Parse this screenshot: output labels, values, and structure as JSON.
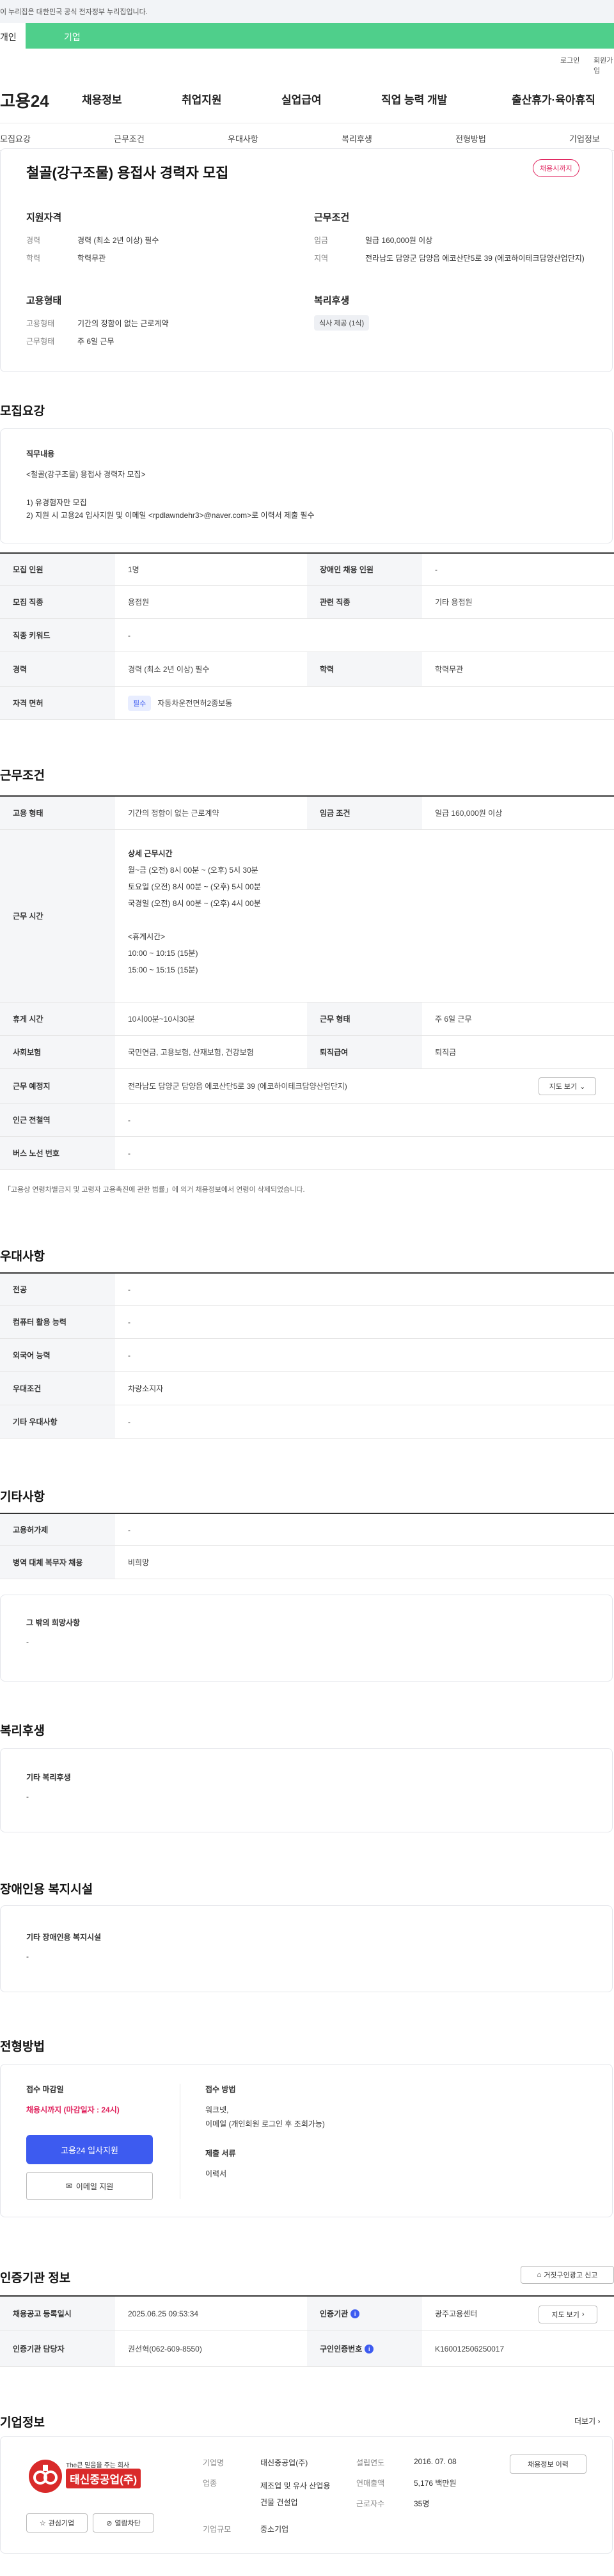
{
  "topbar": {
    "notice": "이 누리집은 대한민국 공식 전자정부 누리집입니다."
  },
  "site_tabs": [
    "개인",
    "기업"
  ],
  "util_links": [
    "로그인",
    "회원가입"
  ],
  "logo": "고용24",
  "gnb": [
    "채용정보",
    "취업지원",
    "실업급여",
    "직업 능력 개발",
    "출산휴가·육아휴직"
  ],
  "subnav": [
    "모집요강",
    "근무조건",
    "우대사항",
    "복리후생",
    "전형방법",
    "기업정보"
  ],
  "header": {
    "title": "철골(강구조물) 용접사 경력자 모집",
    "deadline_badge": "채용시까지",
    "qual_title": "지원자격",
    "qual": [
      {
        "label": "경력",
        "value": "경력 (최소 2년 이상) 필수"
      },
      {
        "label": "학력",
        "value": "학력무관"
      }
    ],
    "cond_title": "근무조건",
    "cond": [
      {
        "label": "임금",
        "value": "일급 160,000원 이상"
      },
      {
        "label": "지역",
        "value": "전라남도 담양군 담양읍 에코산단5로 39 (에코하이테크담양산업단지)"
      }
    ],
    "emp_title": "고용형태",
    "emp": [
      {
        "label": "고용형태",
        "value": "기간의 정함이 없는 근로계약"
      },
      {
        "label": "근무형태",
        "value": "주 6일 근무"
      }
    ],
    "welfare_title": "복리후생",
    "welfare_tag": "식사 제공 (1식)"
  },
  "recruit": {
    "title": "모집요강",
    "duty_label": "직무내용",
    "duty_lines": [
      "<철골(강구조물) 용접사 경력자 모집>",
      "",
      "1) 유경험자만 모집",
      "2) 지원 시 고용24 입사지원 및 이메일 <rpdlawndehr3>@naver.com>로 이력서 제출 필수"
    ],
    "rows": [
      {
        "k1": "모집 인원",
        "v1": "1명",
        "k2": "장애인 채용 인원",
        "v2": "-"
      },
      {
        "k1": "모집 직종",
        "v1": "용접원",
        "k2": "관련 직종",
        "v2": "기타 용접원"
      },
      {
        "k1": "직종 키워드",
        "v1": "-"
      },
      {
        "k1": "경력",
        "v1": "경력 (최소 2년 이상) 필수",
        "k2": "학력",
        "v2": "학력무관"
      }
    ],
    "license_label": "자격 면허",
    "license_tag": "필수",
    "license_value": "자동차운전면허2종보통"
  },
  "work": {
    "title": "근무조건",
    "type_label": "고용 형태",
    "type_value": "기간의 정함이 없는 근로계약",
    "pay_label": "임금 조건",
    "pay_value": "일급 160,000원 이상",
    "hours_label": "근무 시간",
    "hours_lines": [
      "상세 근무시간",
      "월~금  (오전) 8시 00분 ~ (오후) 5시 30분",
      "토요일  (오전) 8시 00분 ~ (오후) 5시 00분",
      "국경일  (오전) 8시 00분 ~ (오후) 4시 00분",
      "",
      "<휴게시간>",
      "10:00 ~ 10:15 (15분)",
      "15:00 ~ 15:15 (15분)"
    ],
    "rest_label": "휴게 시간",
    "rest_value": "10시00분~10시30분",
    "form_label": "근무 형태",
    "form_value": "주 6일 근무",
    "ins_label": "사회보험",
    "ins_value": "국민연금, 고용보험, 산재보험, 건강보험",
    "sev_label": "퇴직급여",
    "sev_value": "퇴직금",
    "place_label": "근무 예정지",
    "place_value": "전라남도 담양군 담양읍 에코산단5로 39 (에코하이테크담양산업단지)",
    "map_btn": "지도 보기",
    "subway_label": "인근 전철역",
    "subway_value": "-",
    "bus_label": "버스 노선 번호",
    "bus_value": "-",
    "note": "「고용상 연령차별금지 및 고령자 고용촉진에 관한 법률」에 의거 채용정보에서 연령이 삭제되었습니다."
  },
  "pref": {
    "title": "우대사항",
    "rows": [
      {
        "k": "전공",
        "v": "-"
      },
      {
        "k": "컴퓨터 활용 능력",
        "v": "-"
      },
      {
        "k": "외국어 능력",
        "v": "-"
      },
      {
        "k": "우대조건",
        "v": "차량소지자"
      },
      {
        "k": "기타 우대사항",
        "v": "-"
      }
    ]
  },
  "other": {
    "title": "기타사항",
    "rows": [
      {
        "k": "고용허가제",
        "v": "-"
      },
      {
        "k": "병역 대체 복무자 채용",
        "v": "비희망"
      }
    ],
    "box_label": "그 밖의 희망사항",
    "box_value": "-"
  },
  "welfare": {
    "title": "복리후생",
    "box_label": "기타 복리후생",
    "box_value": "-"
  },
  "disabled": {
    "title": "장애인용 복지시설",
    "box_label": "기타 장애인용 복지시설",
    "box_value": "-"
  },
  "process": {
    "title": "전형방법",
    "deadline_label": "접수 마감일",
    "deadline_value": "채용시까지 (마감일자 : 24시)",
    "apply_btn": "고용24 입사지원",
    "email_btn": "이메일 지원",
    "method_label": "접수 방법",
    "method_value": "워크넷,",
    "method_value2": "이메일 (개인회원 로그인 후 조회가능)",
    "docs_label": "제출 서류",
    "docs_value": "이력서"
  },
  "cert": {
    "title": "인증기관 정보",
    "report_btn": "거짓구인광고 신고",
    "r1": {
      "k1": "채용공고 등록일시",
      "v1": "2025.06.25 09:53:34",
      "k2": "인증기관",
      "v2": "광주고용센터",
      "btn": "지도 보기"
    },
    "r2": {
      "k1": "인증기관 담당자",
      "v1": "권선혁(062-609-8550)",
      "k2": "구인인증번호",
      "v2": "K160012506250017"
    }
  },
  "company": {
    "title": "기업정보",
    "more": "더보기",
    "logo_tagline": "The큰 믿음을 주는 회사",
    "logo_name": "태신중공업(주)",
    "interest_btn": "관심기업",
    "block_btn": "열람차단",
    "name_label": "기업명",
    "name_value": "태신중공업(주)",
    "biz_label": "업종",
    "biz_value": "제조업 및 유사 산업용 건물 건설업",
    "size_label": "기업규모",
    "size_value": "중소기업",
    "found_label": "설립연도",
    "found_value": "2016. 07. 08",
    "sales_label": "연매출액",
    "sales_value": "5,176 백만원",
    "emp_label": "근로자수",
    "emp_value": "35명",
    "jobs_btn": "채용정보 이력"
  },
  "colors": {
    "brand_green": "#4fcf8b",
    "accent_red": "#e0245e",
    "primary_blue": "#3d5bf0"
  }
}
